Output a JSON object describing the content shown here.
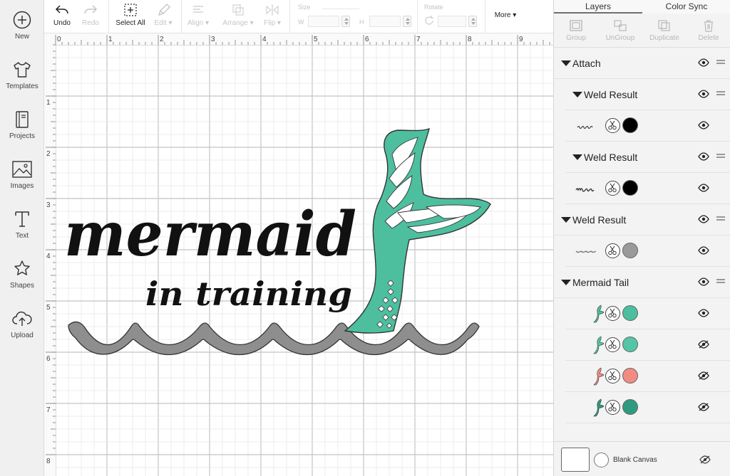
{
  "sidebar": {
    "items": [
      {
        "label": "New",
        "icon": "plus-circle-icon"
      },
      {
        "label": "Templates",
        "icon": "tshirt-icon"
      },
      {
        "label": "Projects",
        "icon": "book-icon"
      },
      {
        "label": "Images",
        "icon": "image-icon"
      },
      {
        "label": "Text",
        "icon": "text-t-icon"
      },
      {
        "label": "Shapes",
        "icon": "shapes-icon"
      },
      {
        "label": "Upload",
        "icon": "cloud-upload-icon"
      }
    ]
  },
  "toolbar": {
    "undo": "Undo",
    "redo": "Redo",
    "select_all": "Select All",
    "edit": "Edit",
    "align": "Align",
    "arrange": "Arrange",
    "flip": "Flip",
    "size": "Size",
    "w": "W",
    "h": "H",
    "rotate": "Rotate",
    "more": "More"
  },
  "canvas": {
    "ruler_top": [
      "0",
      "1",
      "2",
      "3",
      "4",
      "5",
      "6",
      "7",
      "8",
      "9"
    ],
    "ruler_left": [
      "1",
      "2",
      "3",
      "4",
      "5",
      "6",
      "7",
      "8"
    ],
    "text_line1": "mermaid",
    "text_line2": "in training",
    "colors": {
      "text": "#111111",
      "waves": "#8e8e8e",
      "tail": "#4dbf9f"
    }
  },
  "panel": {
    "tabs": [
      "Layers",
      "Color Sync"
    ],
    "tools": [
      "Group",
      "UnGroup",
      "Duplicate",
      "Delete"
    ],
    "layers": [
      {
        "kind": "group",
        "name": "Attach",
        "visible": true
      },
      {
        "kind": "subgroup",
        "name": "Weld Result",
        "visible": true
      },
      {
        "kind": "item",
        "thumb": "text-in-training",
        "color": "#000000",
        "visible": true
      },
      {
        "kind": "subgroup",
        "name": "Weld Result",
        "visible": true
      },
      {
        "kind": "item",
        "thumb": "text-mermaid",
        "color": "#000000",
        "visible": true
      },
      {
        "kind": "group",
        "name": "Weld Result",
        "visible": true
      },
      {
        "kind": "item",
        "thumb": "waves",
        "color": "#9a9a9a",
        "visible": true
      },
      {
        "kind": "group",
        "name": "Mermaid Tail",
        "visible": true
      },
      {
        "kind": "item",
        "thumb": "tail",
        "color": "#4cbf9e",
        "visible": true
      },
      {
        "kind": "item",
        "thumb": "tail",
        "color": "#55c6a5",
        "visible": false
      },
      {
        "kind": "item",
        "thumb": "tail",
        "color": "#f28b82",
        "visible": false
      },
      {
        "kind": "item",
        "thumb": "tail",
        "color": "#2e9b7f",
        "visible": false
      }
    ],
    "blank_canvas": "Blank Canvas"
  }
}
